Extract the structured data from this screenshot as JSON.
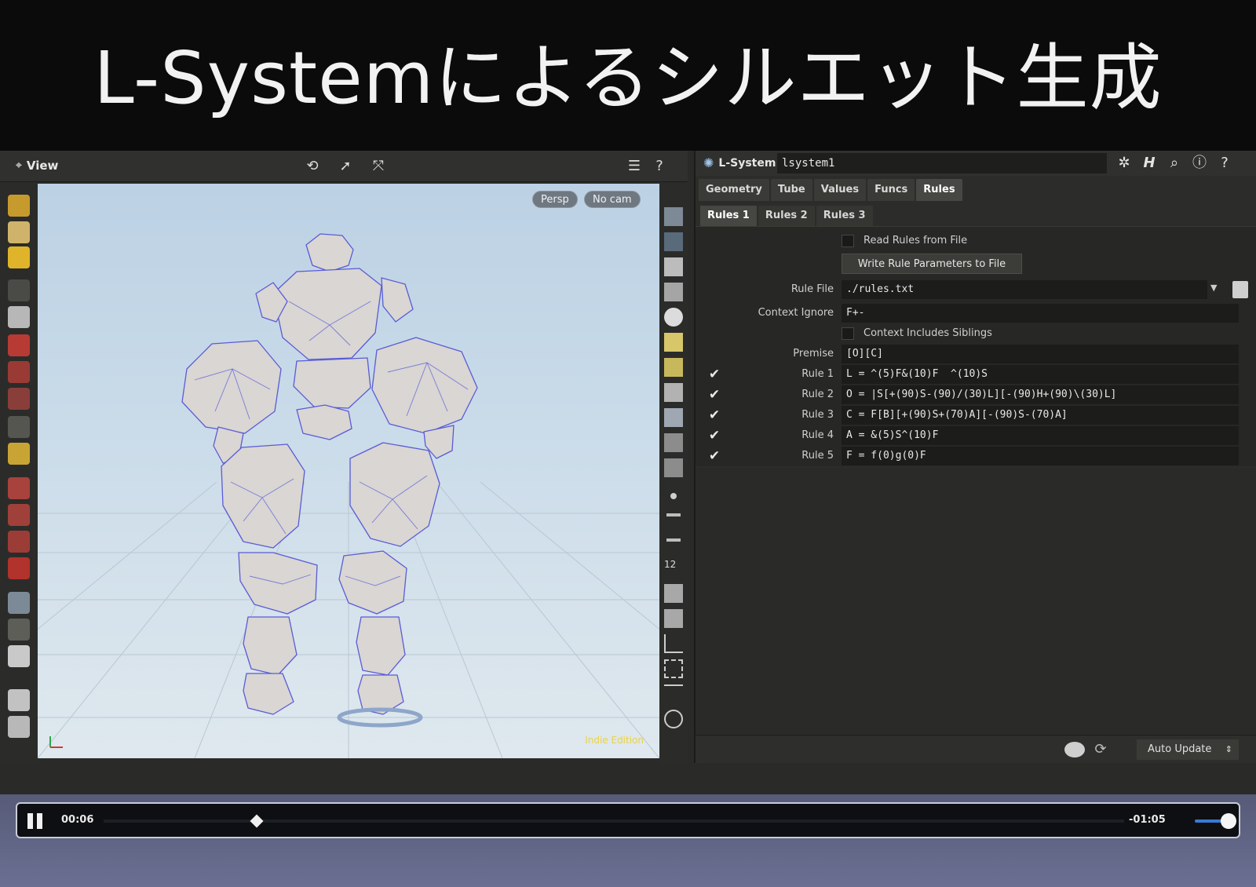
{
  "slide": {
    "title": "L-Systemによるシルエット生成"
  },
  "viewport": {
    "header_title": "View",
    "camera_pills": [
      "Persp",
      "No cam"
    ],
    "watermark": "Indie Edition"
  },
  "params": {
    "node_type": "L-System",
    "node_name": "lsystem1",
    "tabs": [
      "Geometry",
      "Tube",
      "Values",
      "Funcs",
      "Rules"
    ],
    "active_tab": 4,
    "subtabs": [
      "Rules 1",
      "Rules 2",
      "Rules 3"
    ],
    "active_subtab": 0,
    "read_rules_label": "Read Rules from File",
    "write_button": "Write Rule Parameters to File",
    "rule_file_label": "Rule File",
    "rule_file_value": "./rules.txt",
    "context_ignore_label": "Context Ignore",
    "context_ignore_value": "F+-",
    "context_siblings_label": "Context Includes Siblings",
    "premise_label": "Premise",
    "premise_value": "[O][C]",
    "rules": [
      {
        "label": "Rule 1",
        "value": "L = ^(5)F&(10)F  ^(10)S"
      },
      {
        "label": "Rule 2",
        "value": "O = |S[+(90)S-(90)/(30)L][-(90)H+(90)\\(30)L]"
      },
      {
        "label": "Rule 3",
        "value": "C = F[B][+(90)S+(70)A][-(90)S-(70)A]"
      },
      {
        "label": "Rule 4",
        "value": "A = &(5)S^(10)F"
      },
      {
        "label": "Rule 5",
        "value": "F = f(0)g(0)F"
      }
    ],
    "auto_update": "Auto Update"
  },
  "player": {
    "elapsed": "00:06",
    "remaining": "-01:05",
    "progress": 0.15,
    "volume": 0.9
  }
}
